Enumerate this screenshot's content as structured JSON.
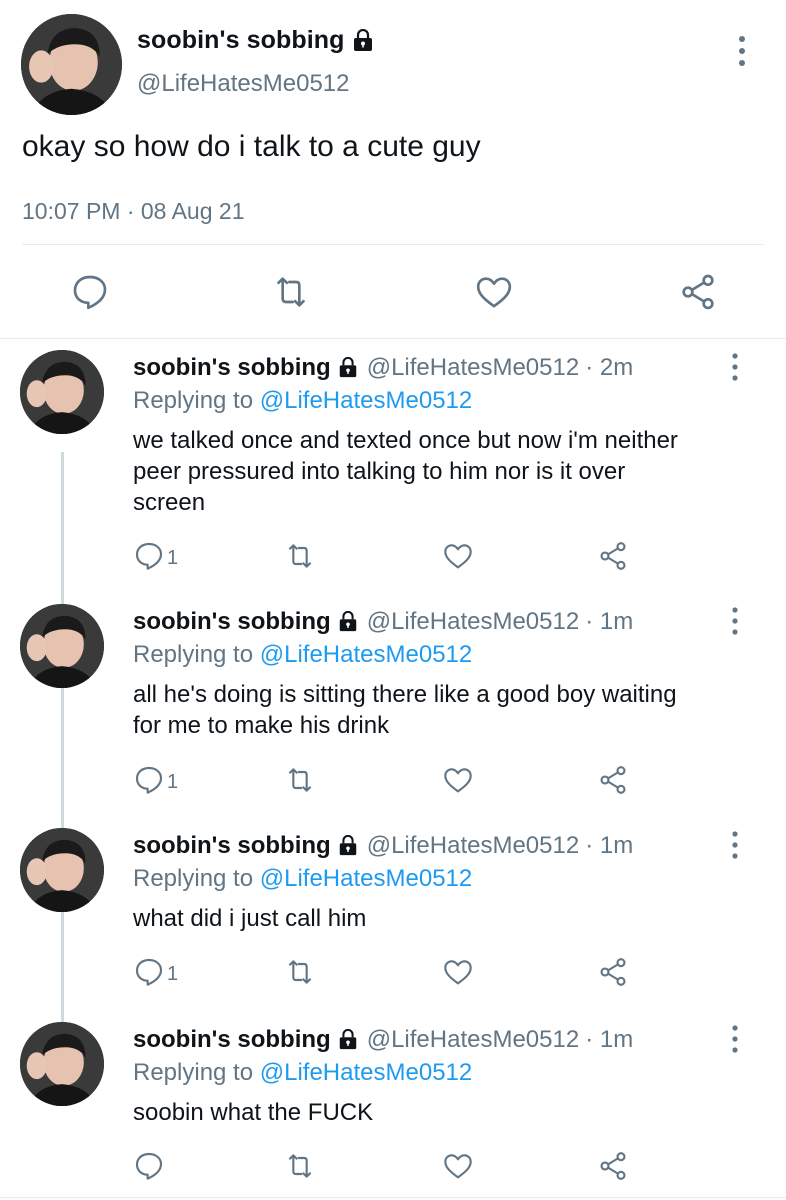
{
  "main_tweet": {
    "display_name": "soobin's sobbing",
    "handle": "@LifeHatesMe0512",
    "text": "okay so how do i talk to a cute guy",
    "timestamp": "10:07 PM · 08 Aug 21"
  },
  "replies": [
    {
      "display_name": "soobin's sobbing",
      "handle": "@LifeHatesMe0512",
      "time": "· 2m",
      "replying_label": "Replying to",
      "replying_handle": "@LifeHatesMe0512",
      "lines": [
        "we talked once and texted once but now i'm neither",
        "peer pressured into talking to him nor is it over",
        "screen"
      ],
      "reply_count": "1"
    },
    {
      "display_name": "soobin's sobbing",
      "handle": "@LifeHatesMe0512",
      "time": "· 1m",
      "replying_label": "Replying to",
      "replying_handle": "@LifeHatesMe0512",
      "lines": [
        "all he's doing is sitting there like a good boy waiting",
        "for me to make his drink"
      ],
      "reply_count": "1"
    },
    {
      "display_name": "soobin's sobbing",
      "handle": "@LifeHatesMe0512",
      "time": "· 1m",
      "replying_label": "Replying to",
      "replying_handle": "@LifeHatesMe0512",
      "lines": [
        "what did i just call him"
      ],
      "reply_count": "1"
    },
    {
      "display_name": "soobin's sobbing",
      "handle": "@LifeHatesMe0512",
      "time": "· 1m",
      "replying_label": "Replying to",
      "replying_handle": "@LifeHatesMe0512",
      "lines": [
        "soobin what the FUCK"
      ],
      "reply_count": ""
    }
  ],
  "icons": {
    "reply": "speech-bubble-icon",
    "retweet": "retweet-icon",
    "like": "heart-icon",
    "share": "share-icon",
    "more": "more-vertical-icon",
    "protected": "lock-icon"
  },
  "colors": {
    "text": "#0f1419",
    "secondary": "#627584",
    "link": "#1d9bf0",
    "divider": "#e6ecf0",
    "thread_line": "#cfd9de"
  }
}
